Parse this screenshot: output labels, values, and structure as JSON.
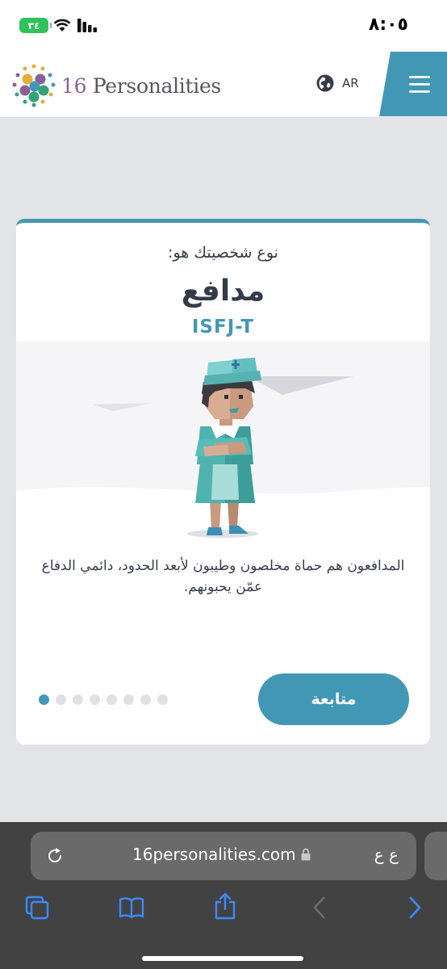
{
  "status_bar": {
    "battery": "٣٤",
    "time": "٨:٠٥",
    "icons": [
      "wifi-icon",
      "signal-icon",
      "battery-icon"
    ]
  },
  "header": {
    "logo_number": "16",
    "logo_word": "Personalities",
    "language": "AR",
    "icons": [
      "globe-icon",
      "hamburger-menu-icon"
    ]
  },
  "card": {
    "label": "نوع شخصيتك هو:",
    "type_name": "مدافع",
    "type_code": "ISFJ-T",
    "description": "المدافعون هم حماة مخلصون وطيبون لأبعد الحدود، دائمي الدفاع عمّن يحبونهم.",
    "continue_label": "متابعة",
    "pagination": {
      "total": 8,
      "active_index": 0
    }
  },
  "browser": {
    "url": "16personalities.com",
    "aa_label": "ع ع",
    "toolbar_icons": [
      "tabs-icon",
      "bookmarks-icon",
      "share-icon",
      "back-icon",
      "forward-icon"
    ]
  },
  "colors": {
    "accent": "#4298b4",
    "text": "#343c4b",
    "page_bg": "#e3e4e8",
    "battery_green": "#2fc15a",
    "safari_bar": "#434243",
    "ios_blue": "#3a8bff"
  }
}
